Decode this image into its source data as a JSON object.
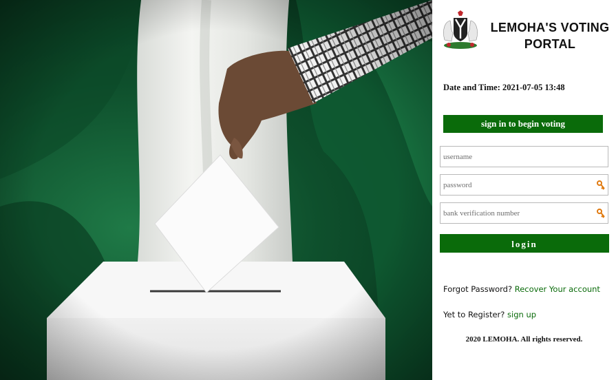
{
  "portal": {
    "title_line1": "LEMOHA'S VOTING",
    "title_line2": "PORTAL"
  },
  "datetime": {
    "label": "Date and Time:",
    "value": "2021-07-05 13:48"
  },
  "signin_banner": "sign in to begin voting",
  "form": {
    "username_placeholder": "username",
    "password_placeholder": "password",
    "bvn_placeholder": "bank verification number",
    "login_label": "login"
  },
  "forgot": {
    "text": "Forgot Password?",
    "link": "Recover Your account"
  },
  "register": {
    "text": "Yet to Register?",
    "link": "sign up"
  },
  "copyright": "2020 LEMOHA. All rights reserved.",
  "icons": {
    "crest": "nigeria-coat-of-arms-icon",
    "key": "key-icon"
  },
  "colors": {
    "accent_green": "#0a6b0a",
    "flag_green": "#0e6b3a"
  }
}
